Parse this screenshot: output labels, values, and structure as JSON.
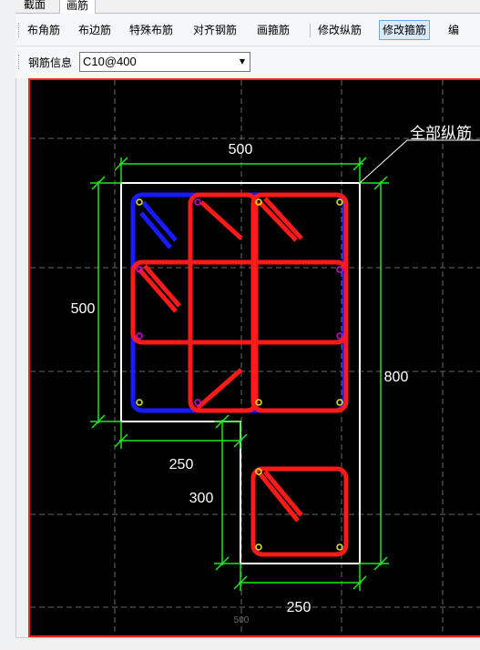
{
  "tabs": [
    {
      "label": "截面"
    },
    {
      "label": "画筋"
    }
  ],
  "toolbar": {
    "buttons": [
      {
        "label": "布角筋"
      },
      {
        "label": "布边筋"
      },
      {
        "label": "特殊布筋"
      },
      {
        "label": "对齐钢筋"
      },
      {
        "label": "画箍筋"
      },
      {
        "label": "修改纵筋"
      },
      {
        "label": "修改箍筋"
      },
      {
        "label": "编"
      }
    ],
    "selected_button": "修改箍筋"
  },
  "rebar_info": {
    "label": "钢筋信息",
    "value": "C10@400"
  },
  "drawing": {
    "dimensions": {
      "top_width": "500",
      "left_height": "500",
      "right_height": "800",
      "notch_width": "250",
      "notch_height": "300",
      "bottom_width": "250",
      "axis_bottom": "500"
    },
    "annotation": "全部纵筋",
    "colors": {
      "background": "#000000",
      "outline": "#ffffff",
      "dimension": "#1ee81e",
      "stirrup_red": "#ff1a1a",
      "stirrup_blue": "#1a1aff",
      "rebar_yellow": "#e8e800",
      "rebar_magenta": "#d400d4",
      "border": "#ff1f1f"
    }
  }
}
